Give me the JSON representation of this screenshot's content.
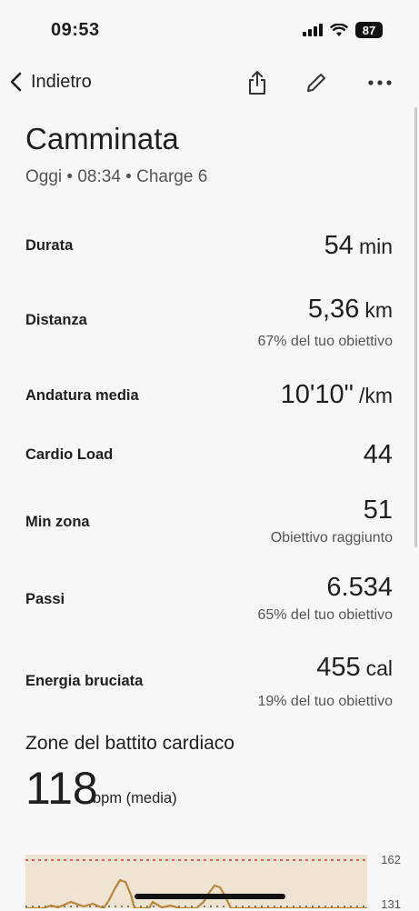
{
  "status_bar": {
    "time": "09:53",
    "battery": "87"
  },
  "nav": {
    "back_label": "Indietro"
  },
  "header": {
    "title": "Camminata",
    "subtitle": "Oggi • 08:34 • Charge 6"
  },
  "metrics": [
    {
      "label": "Durata",
      "value": "54",
      "unit": "min",
      "sub": ""
    },
    {
      "label": "Distanza",
      "value": "5,36",
      "unit": "km",
      "sub": "67% del tuo obiettivo"
    },
    {
      "label": "Andatura media",
      "value": "10'10\"",
      "unit": "/km",
      "sub": ""
    },
    {
      "label": "Cardio Load",
      "value": "44",
      "unit": "",
      "sub": ""
    },
    {
      "label": "Min zona",
      "value": "51",
      "unit": "",
      "sub": "Obiettivo raggiunto"
    },
    {
      "label": "Passi",
      "value": "6.534",
      "unit": "",
      "sub": "65% del tuo obiettivo"
    },
    {
      "label": "Energia bruciata",
      "value": "455",
      "unit": "cal",
      "sub": "19% del tuo obiettivo"
    }
  ],
  "heart_rate": {
    "section_title": "Zone del battito cardiaco",
    "value": "118",
    "unit": "bpm (media)",
    "axis_top": "162",
    "axis_bottom": "131"
  },
  "colors": {
    "accent_red": "#d9342b",
    "trace": "#b8863b",
    "chart_bg": "#efe3d2"
  }
}
